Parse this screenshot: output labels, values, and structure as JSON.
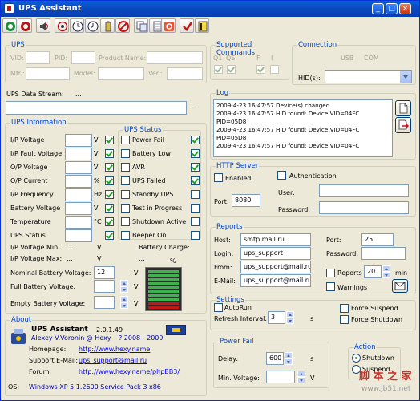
{
  "window": {
    "title": "UPS Assistant"
  },
  "titlebar_buttons": {
    "minimize": "_",
    "maximize": "□",
    "close": "×"
  },
  "toolbar": {
    "buttons": [
      "connect-icon",
      "disconnect-icon",
      "sound-icon",
      "settings-icon",
      "clock-icon",
      "schedule-icon",
      "battery-icon",
      "stop-icon",
      "copy-icon",
      "page-icon",
      "power-icon",
      "check-icon",
      "help-icon"
    ]
  },
  "ups": {
    "legend": "UPS",
    "vid_label": "VID:",
    "pid_label": "PID:",
    "product_label": "Product Name:",
    "mfr_label": "Mfr.:",
    "model_label": "Model:",
    "ver_label": "Ver.:",
    "vid": "",
    "pid": "",
    "product": "",
    "mfr": "",
    "model": "",
    "ver": ""
  },
  "supported": {
    "legend": "Supported Commands",
    "labels": [
      "Q1",
      "QS",
      "F",
      "I"
    ],
    "checked": [
      true,
      true,
      true,
      false
    ]
  },
  "connection": {
    "legend": "Connection",
    "usb": "USB",
    "com": "COM",
    "hid_label": "HID(s):",
    "hid_value": ""
  },
  "stream": {
    "label": "UPS Data Stream:",
    "dots": "...",
    "value": "",
    "dash": "-"
  },
  "info": {
    "legend": "UPS Information",
    "rows": [
      {
        "label": "I/P Voltage",
        "unit": "V"
      },
      {
        "label": "I/P Fault Voltage",
        "unit": "V"
      },
      {
        "label": "O/P Voltage",
        "unit": "V"
      },
      {
        "label": "O/P Current",
        "unit": "%"
      },
      {
        "label": "I/P Frequency",
        "unit": "Hz"
      },
      {
        "label": "Battery Voltage",
        "unit": "V"
      },
      {
        "label": "Temperature",
        "unit": "°C"
      },
      {
        "label": "UPS Status",
        "unit": ""
      }
    ],
    "ipmin_label": "I/P Voltage Min:",
    "ipmin_dots": "...",
    "ipmin_unit": "V",
    "ipmax_label": "I/P Voltage Max:",
    "ipmax_dots": "...",
    "ipmax_unit": "V",
    "battery_charge_label": "Battery Charge:",
    "battery_charge_dots": "...",
    "battery_charge_unit": "%",
    "nominal_label": "Nominal Battery Voltage:",
    "nominal_value": "12",
    "nominal_unit": "V",
    "full_label": "Full Battery Voltage:",
    "full_unit": "V",
    "empty_label": "Empty Battery Voltage:",
    "empty_unit": "V",
    "battery_level": 0.2
  },
  "status": {
    "legend": "UPS Status",
    "items": [
      "Power Fail",
      "Battery Low",
      "AVR",
      "UPS Failed",
      "Standby UPS",
      "Test in Progress",
      "Shutdown Active",
      "Beeper On"
    ],
    "alarm_checked": [
      true,
      true,
      true,
      true,
      false,
      false,
      false,
      false
    ]
  },
  "log": {
    "legend": "Log",
    "text": "2009-4-23 16:47:57 Device(s) changed\n2009-4-23 16:47:57 HID found: Device VID=04FC\nPID=05D8\n2009-4-23 16:47:57 HID found: Device VID=04FC\nPID=05D8\n2009-4-23 16:47:57 HID found: Device VID=04FC"
  },
  "http": {
    "legend": "HTTP Server",
    "enabled": "Enabled",
    "auth": "Authentication",
    "user_label": "User:",
    "password_label": "Password:",
    "port_label": "Port:",
    "port": "8080",
    "user": "",
    "password": ""
  },
  "reports": {
    "legend": "Reports",
    "host_label": "Host:",
    "host": "smtp.mail.ru",
    "port_label": "Port:",
    "port": "25",
    "login_label": "Login:",
    "login": "ups_support",
    "password_label": "Password:",
    "password": "",
    "from_label": "From:",
    "from": "ups_support@mail.ru",
    "email_label": "E-Mail:",
    "email": "ups_support@mail.ru",
    "reports_label": "Reports",
    "reports_value": "20",
    "min": "min",
    "warnings_label": "Warnings"
  },
  "settings": {
    "legend": "Settings",
    "autorun": "AutoRun",
    "refresh_label": "Refresh Interval:",
    "refresh": "3",
    "s": "s",
    "force_suspend": "Force Suspend",
    "force_shutdown": "Force Shutdown"
  },
  "power_fail": {
    "legend": "Power Fail",
    "delay_label": "Delay:",
    "delay": "600",
    "s": "s",
    "minv_label": "Min. Voltage:",
    "minv": "",
    "v": "V"
  },
  "action": {
    "legend": "Action",
    "shutdown": "Shutdown",
    "suspend": "Suspend",
    "selected": "Shutdown"
  },
  "about": {
    "legend": "About",
    "name": "UPS Assistant",
    "version": "2.0.1.49",
    "author": "Alexey V.Voronin @ Hexy",
    "years": "? 2008 - 2009",
    "homepage_label": "Homepage:",
    "homepage": "http://www.hexy.name",
    "support_label": "Support E-Mail:",
    "support": "ups_support@mail.ru",
    "forum_label": "Forum:",
    "forum": "http://www.hexy.name/phpBB3/",
    "os_label": "OS:",
    "os": "Windows XP 5.1.2600 Service Pack 3 x86"
  },
  "watermark": {
    "brand": "脚 本 之 家",
    "url": "www.jb51.net"
  },
  "colors": {
    "legend": "#0046d5",
    "title_blue": "#0a5fd8",
    "check": "#21a121",
    "battery_red": "#c01818",
    "battery_green": "#3cb44b"
  }
}
